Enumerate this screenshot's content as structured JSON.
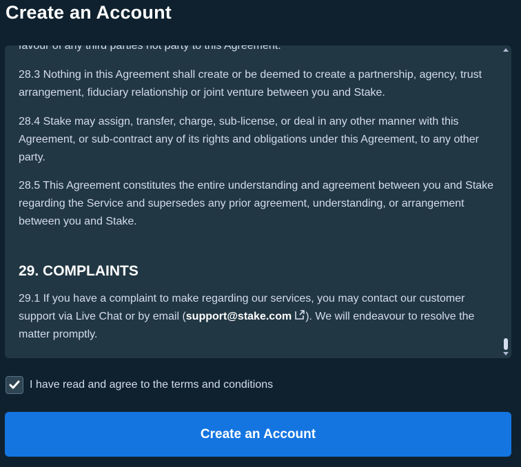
{
  "page_title": "Create an Account",
  "terms": {
    "partial_top": "favour of any third parties not party to this Agreement.",
    "p_28_3": "28.3 Nothing in this Agreement shall create or be deemed to create a partnership, agency, trust arrangement, fiduciary relationship or joint venture between you and Stake.",
    "p_28_4": "28.4 Stake may assign, transfer, charge, sub-license, or deal in any other manner with this Agreement, or sub-contract any of its rights and obligations under this Agreement, to any other party.",
    "p_28_5": "28.5 This Agreement constitutes the entire understanding and agreement between you and Stake regarding the Service and supersedes any prior agreement, understanding, or arrangement between you and Stake.",
    "heading_29": "29. COMPLAINTS",
    "p_29_1_before": "29.1 If you have a complaint to make regarding our services, you may contact our customer support via Live Chat or by email (",
    "p_29_1_email": "support@stake.com",
    "p_29_1_after": "). We will endeavour to resolve the matter promptly."
  },
  "agree": {
    "checked": true,
    "label": "I have read and agree to the terms and conditions"
  },
  "submit_label": "Create an Account",
  "icons": {
    "checkbox": "check-icon",
    "email_link": "external-link-icon"
  },
  "colors": {
    "background": "#0f212e",
    "panel": "#213743",
    "button": "#1475e1",
    "text_muted": "#d5dceb"
  }
}
